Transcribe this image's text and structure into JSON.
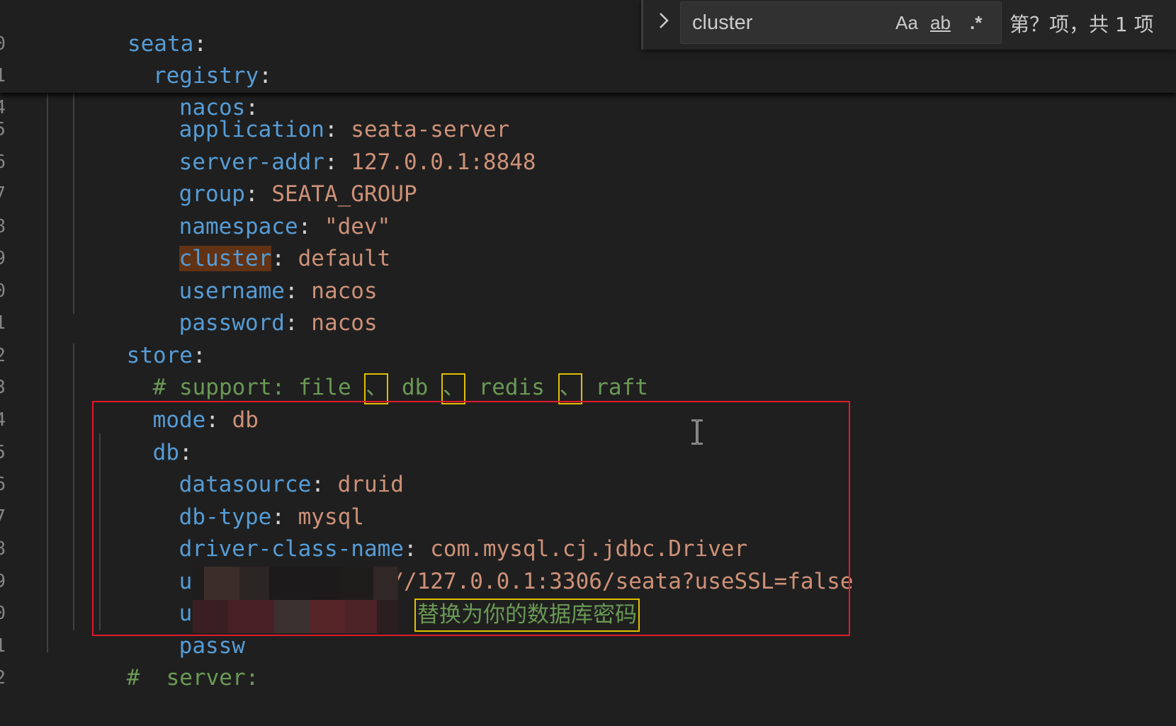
{
  "find": {
    "query": "cluster",
    "match_case": "Aa",
    "whole_word": "ab",
    "regex": ".*",
    "result": "第？项，共 1 项"
  },
  "code": {
    "l1": {
      "num": "0",
      "key": "seata",
      "colon": ":"
    },
    "l2": {
      "num": "1",
      "key": "registry",
      "colon": ":"
    },
    "l3": {
      "num": "4",
      "key": "nacos",
      "colon": ":"
    },
    "l4": {
      "num": "5",
      "key": "application",
      "colon": ": ",
      "value": "seata-server"
    },
    "l5": {
      "num": "6",
      "key": "server-addr",
      "colon": ": ",
      "value": "127.0.0.1:8848"
    },
    "l6": {
      "num": "7",
      "key": "group",
      "colon": ": ",
      "value": "SEATA_GROUP"
    },
    "l7": {
      "num": "8",
      "key": "namespace",
      "colon": ": ",
      "value": "\"dev\""
    },
    "l8": {
      "num": "9",
      "key": "cluster",
      "colon": ": ",
      "value": "default"
    },
    "l9": {
      "num": "0",
      "key": "username",
      "colon": ": ",
      "value": "nacos"
    },
    "l10": {
      "num": "1",
      "key": "password",
      "colon": ": ",
      "value": "nacos"
    },
    "l11": {
      "num": "2",
      "key": "store",
      "colon": ":"
    },
    "l12": {
      "num": "3",
      "prefix": "# support: file ",
      "sep": "、",
      "p2": " db ",
      "p3": " redis ",
      "p4": " raft"
    },
    "l13": {
      "num": "4",
      "key": "mode",
      "colon": ": ",
      "value": "db"
    },
    "l14": {
      "num": "5",
      "key": "db",
      "colon": ":"
    },
    "l15": {
      "num": "6",
      "key": "datasource",
      "colon": ": ",
      "value": "druid"
    },
    "l16": {
      "num": "7",
      "key": "db-type",
      "colon": ": ",
      "value": "mysql"
    },
    "l17": {
      "num": "8",
      "key": "driver-class-name",
      "colon": ": ",
      "value": "com.mysql.cj.jdbc.Driver"
    },
    "l18": {
      "num": "9",
      "key": "url",
      "colon": ": ",
      "value": "jdbc:mysql://127.0.0.1:3306/seata?useSSL=false"
    },
    "l19": {
      "num": "0",
      "key": "user",
      "colon": ":"
    },
    "l20": {
      "num": "1",
      "key": "passw",
      "comment": "替换为你的数据库密码"
    },
    "l21": {
      "num": "2",
      "text": "#  server:"
    }
  },
  "colors": {
    "key": "#569cd6",
    "value": "#ce9178",
    "comment": "#6a9955",
    "highlight_box": "#e0192c",
    "annotation_box": "#e0c000",
    "find_match": "#613214"
  }
}
